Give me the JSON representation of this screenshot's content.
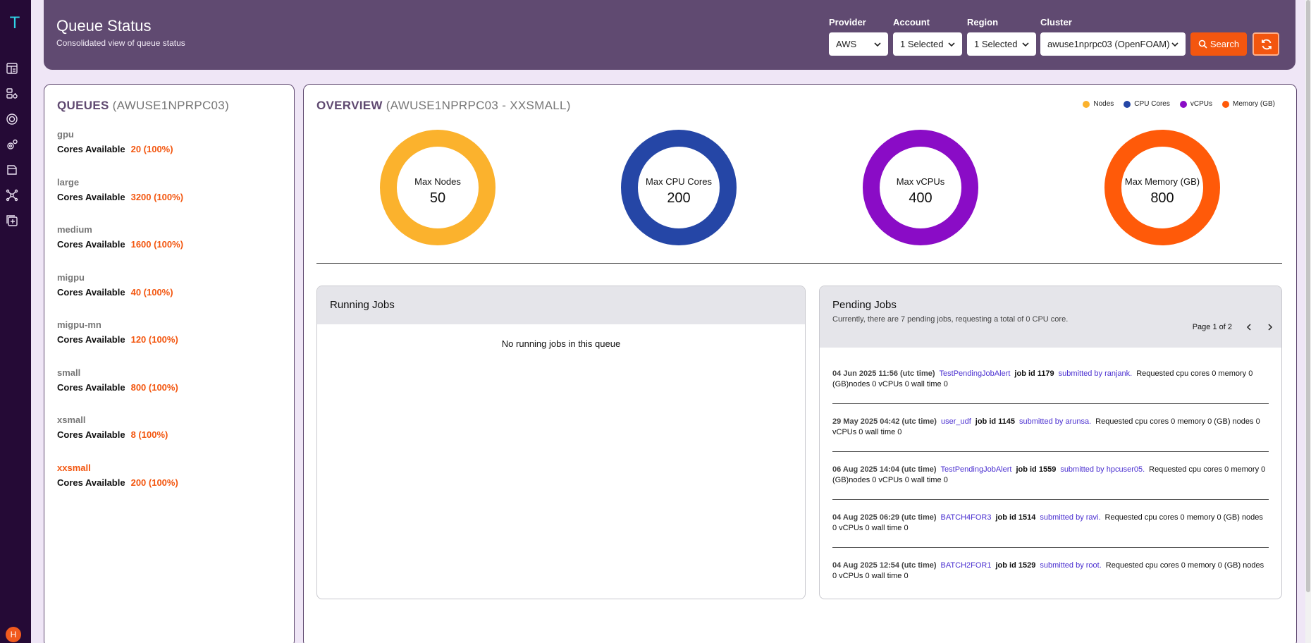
{
  "rail": {
    "logo": "T",
    "nav": [
      "dashboard-icon",
      "nodes-config-icon",
      "monitor-icon",
      "settings-icon",
      "files-icon",
      "network-icon",
      "add-icon"
    ],
    "avatar": "H"
  },
  "header": {
    "title": "Queue Status",
    "subtitle": "Consolidated view of queue status",
    "filters": {
      "provider": {
        "label": "Provider",
        "value": "AWS"
      },
      "account": {
        "label": "Account",
        "value": "1 Selected"
      },
      "region": {
        "label": "Region",
        "value": "1 Selected"
      },
      "cluster": {
        "label": "Cluster",
        "value": "awuse1nprpc03 (OpenFOAM)"
      }
    },
    "search_label": "Search"
  },
  "queues": {
    "heading": "QUEUES",
    "cluster": "(AWUSE1NPRPC03)",
    "cores_label": "Cores Available",
    "active": "xxsmall",
    "items": [
      {
        "name": "gpu",
        "cores": "20 (100%)"
      },
      {
        "name": "large",
        "cores": "3200 (100%)"
      },
      {
        "name": "medium",
        "cores": "1600 (100%)"
      },
      {
        "name": "migpu",
        "cores": "40 (100%)"
      },
      {
        "name": "migpu-mn",
        "cores": "120 (100%)"
      },
      {
        "name": "small",
        "cores": "800 (100%)"
      },
      {
        "name": "xsmall",
        "cores": "8 (100%)"
      },
      {
        "name": "xxsmall",
        "cores": "200 (100%)"
      }
    ]
  },
  "overview": {
    "heading": "OVERVIEW",
    "scope": "(AWUSE1NPRPC03 - XXSMALL)",
    "legend": [
      {
        "label": "Nodes",
        "color": "#fbb22d"
      },
      {
        "label": "CPU Cores",
        "color": "#2546a6"
      },
      {
        "label": "vCPUs",
        "color": "#8a0cc6"
      },
      {
        "label": "Memory (GB)",
        "color": "#ff5a09"
      }
    ],
    "metrics": [
      {
        "label": "Max Nodes",
        "value": "50",
        "color": "#fbb22d"
      },
      {
        "label": "Max CPU Cores",
        "value": "200",
        "color": "#2546a6"
      },
      {
        "label": "Max vCPUs",
        "value": "400",
        "color": "#8a0cc6"
      },
      {
        "label": "Max Memory (GB)",
        "value": "800",
        "color": "#ff5a09"
      }
    ]
  },
  "running": {
    "title": "Running Jobs",
    "empty": "No running jobs in this queue"
  },
  "pending": {
    "title": "Pending Jobs",
    "subtitle": "Currently, there are 7 pending jobs, requesting a total of 0 CPU core.",
    "page": "Page 1 of 2",
    "jobs": [
      {
        "time": "04 Jun 2025 11:56 (utc time)",
        "name": "TestPendingJobAlert",
        "id": "job id 1179",
        "by": "submitted by ranjank.",
        "req": "Requested  cpu cores 0  memory 0 (GB)nodes 0  vCPUs 0  wall time 0"
      },
      {
        "time": "29 May 2025 04:42 (utc time)",
        "name": "user_udf",
        "id": "job id 1145",
        "by": "submitted by arunsa.",
        "req": "Requested  cpu cores 0  memory 0 (GB) nodes 0  vCPUs 0  wall time 0"
      },
      {
        "time": "06 Aug 2025 14:04 (utc time)",
        "name": "TestPendingJobAlert",
        "id": "job id 1559",
        "by": "submitted by hpcuser05.",
        "req": "Requested  cpu cores 0  memory 0 (GB)nodes 0  vCPUs 0  wall time 0"
      },
      {
        "time": "04 Aug 2025 06:29 (utc time)",
        "name": "BATCH4FOR3",
        "id": "job id 1514",
        "by": "submitted by ravi.",
        "req": "Requested  cpu cores 0  memory 0 (GB) nodes 0  vCPUs 0  wall time 0"
      },
      {
        "time": "04 Aug 2025 12:54 (utc time)",
        "name": "BATCH2FOR1",
        "id": "job id 1529",
        "by": "submitted by root.",
        "req": "Requested  cpu cores 0  memory 0 (GB) nodes 0  vCPUs 0  wall time 0"
      }
    ]
  }
}
